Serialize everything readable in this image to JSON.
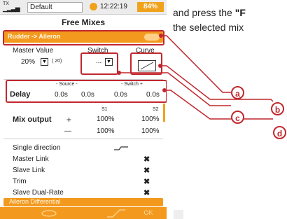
{
  "status_bar": {
    "tx_label": "TX",
    "model_name": "Default",
    "clock": "12:22:19",
    "battery": "84%"
  },
  "title": "Free Mixes",
  "mix_header": {
    "name": "Rudder -> Aileron"
  },
  "fields": {
    "master_value_label": "Master Value",
    "master_value": "20%",
    "master_value_sub": "( 20)",
    "switch_label": "Switch",
    "switch_value": "...",
    "curve_label": "Curve"
  },
  "delay": {
    "label": "Delay",
    "source_minus_label": "- Source -",
    "switch_plus_label": "- Switch +",
    "values": [
      "0.0s",
      "0.0s",
      "0.0s",
      "0.0s"
    ]
  },
  "mix_output": {
    "label": "Mix output",
    "col_s1": "S1",
    "col_s2": "S2",
    "plus_sign": "+",
    "minus_sign": "—",
    "plus_values": [
      "100%",
      "100%"
    ],
    "minus_values": [
      "100%",
      "100%"
    ]
  },
  "options": [
    {
      "label": "Single direction",
      "mark": ""
    },
    {
      "label": "Master Link",
      "mark": "✖"
    },
    {
      "label": "Slave Link",
      "mark": "✖"
    },
    {
      "label": "Trim",
      "mark": "✖"
    },
    {
      "label": "Slave Dual-Rate",
      "mark": "✖"
    }
  ],
  "footer_row": "Aileron Differential",
  "softkeys": [
    "",
    "",
    "",
    "OK"
  ],
  "callouts": [
    "a",
    "b",
    "c",
    "d"
  ],
  "doc_text": {
    "line1_prefix": "and press the ",
    "line1_bold": "\"F",
    "line2": "the selected mix"
  },
  "colors": {
    "accent": "#f39a1e",
    "callout": "#c1272d"
  }
}
